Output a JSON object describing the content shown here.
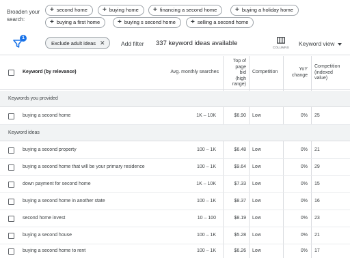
{
  "broaden": {
    "label": "Broaden your search:",
    "chips": [
      "second home",
      "buying home",
      "financing a second home",
      "buying a holiday home",
      "buying a first home",
      "buying s second home",
      "selling a second home"
    ]
  },
  "filterbar": {
    "filter_badge": "1",
    "filter_chip": "Exclude adult ideas",
    "add_filter": "Add filter",
    "ideas_count": "337 keyword ideas available",
    "columns_label": "COLUMNS",
    "view_selector": "Keyword view"
  },
  "table": {
    "headers": {
      "keyword": "Keyword (by relevance)",
      "searches": "Avg. monthly searches",
      "bid": [
        "Top of",
        "page",
        "bid",
        "(high",
        "range)"
      ],
      "competition": "Competition",
      "yoy": [
        "YoY",
        "change"
      ],
      "comp_index": [
        "Competition",
        "(indexed",
        "value)"
      ]
    },
    "group_provided": "Keywords you provided",
    "provided_rows": [
      {
        "keyword": "buying a second home",
        "searches": "1K – 10K",
        "bid": "$6.90",
        "competition": "Low",
        "yoy": "0%",
        "index": "25"
      }
    ],
    "group_ideas": "Keyword ideas",
    "idea_rows": [
      {
        "keyword": "buying a second property",
        "searches": "100 – 1K",
        "bid": "$6.48",
        "competition": "Low",
        "yoy": "0%",
        "index": "21"
      },
      {
        "keyword": "buying a second home that will be your primary residence",
        "searches": "100 – 1K",
        "bid": "$9.64",
        "competition": "Low",
        "yoy": "0%",
        "index": "29"
      },
      {
        "keyword": "down payment for second home",
        "searches": "1K – 10K",
        "bid": "$7.33",
        "competition": "Low",
        "yoy": "0%",
        "index": "15"
      },
      {
        "keyword": "buying a second home in another state",
        "searches": "100 – 1K",
        "bid": "$8.37",
        "competition": "Low",
        "yoy": "0%",
        "index": "16"
      },
      {
        "keyword": "second home invest",
        "searches": "10 – 100",
        "bid": "$8.19",
        "competition": "Low",
        "yoy": "0%",
        "index": "23"
      },
      {
        "keyword": "buying a second house",
        "searches": "100 – 1K",
        "bid": "$5.28",
        "competition": "Low",
        "yoy": "0%",
        "index": "21"
      },
      {
        "keyword": "buying a second home to rent",
        "searches": "100 – 1K",
        "bid": "$6.26",
        "competition": "Low",
        "yoy": "0%",
        "index": "17"
      }
    ]
  },
  "colors": {
    "accent": "#1a73e8",
    "group_bg": "#f1f3f4",
    "border": "#dadce0"
  }
}
